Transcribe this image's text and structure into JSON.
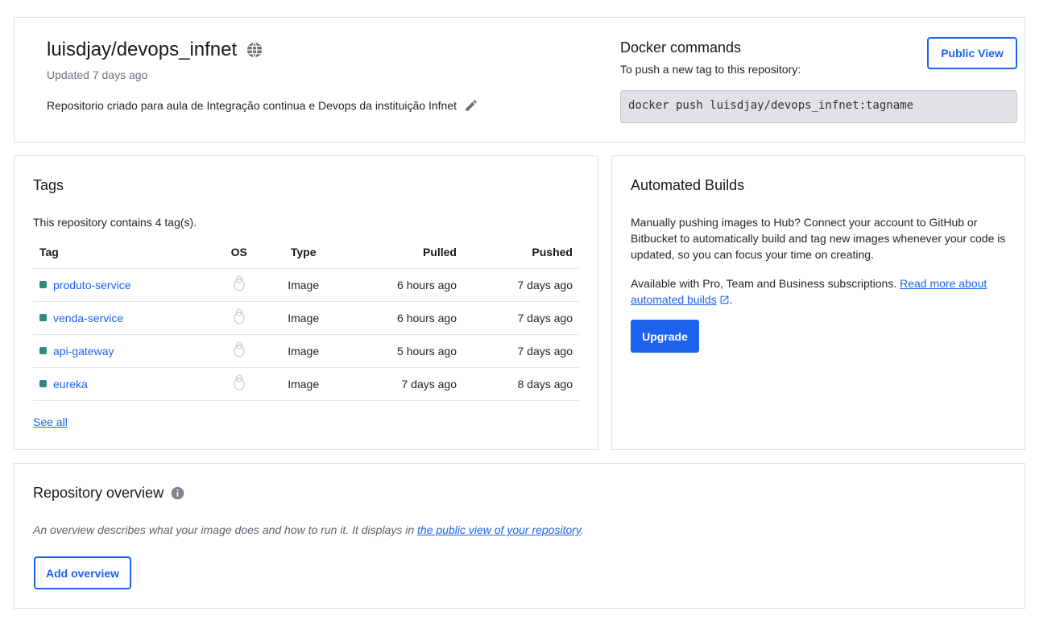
{
  "header": {
    "repo_name": "luisdjay/devops_infnet",
    "updated": "Updated 7 days ago",
    "description": "Repositorio criado para aula de Integração continua e Devops da instituição Infnet",
    "public_view_label": "Public View"
  },
  "docker_commands": {
    "title": "Docker commands",
    "subtitle": "To push a new tag to this repository:",
    "command": "docker push luisdjay/devops_infnet:tagname"
  },
  "tags": {
    "title": "Tags",
    "count_text": "This repository contains 4 tag(s).",
    "columns": {
      "tag": "Tag",
      "os": "OS",
      "type": "Type",
      "pulled": "Pulled",
      "pushed": "Pushed"
    },
    "rows": [
      {
        "name": "produto-service",
        "os_icon": "linux-icon",
        "type": "Image",
        "pulled": "6 hours ago",
        "pushed": "7 days ago"
      },
      {
        "name": "venda-service",
        "os_icon": "linux-icon",
        "type": "Image",
        "pulled": "6 hours ago",
        "pushed": "7 days ago"
      },
      {
        "name": "api-gateway",
        "os_icon": "linux-icon",
        "type": "Image",
        "pulled": "5 hours ago",
        "pushed": "7 days ago"
      },
      {
        "name": "eureka",
        "os_icon": "linux-icon",
        "type": "Image",
        "pulled": "7 days ago",
        "pushed": "8 days ago"
      }
    ],
    "see_all": "See all"
  },
  "automated_builds": {
    "title": "Automated Builds",
    "paragraph1": "Manually pushing images to Hub? Connect your account to GitHub or Bitbucket to automatically build and tag new images whenever your code is updated, so you can focus your time on creating.",
    "paragraph2_prefix": "Available with Pro, Team and Business subscriptions. ",
    "read_more_link": "Read more about automated builds",
    "paragraph2_suffix": ".",
    "upgrade_label": "Upgrade"
  },
  "overview": {
    "title": "Repository overview",
    "text_prefix": "An overview describes what your image does and how to run it. It displays in ",
    "text_link": "the public view of your repository",
    "text_suffix": ".",
    "add_label": "Add overview"
  },
  "colors": {
    "accent": "#1d63ed",
    "tag_status": "#2c8c7d",
    "command_bg": "#e1e2e6"
  }
}
